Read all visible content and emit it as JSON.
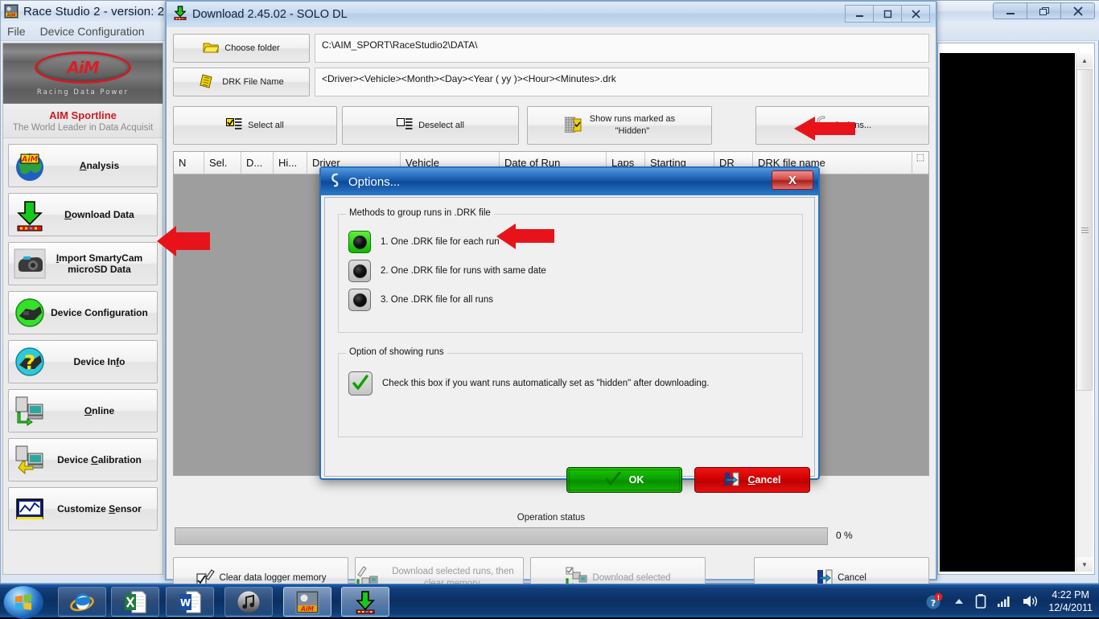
{
  "main_window": {
    "title": "Race Studio 2   - version: 2",
    "icon": "aim-app-icon",
    "menu": [
      "File",
      "Device Configuration"
    ],
    "window_buttons": [
      "minimize",
      "restore",
      "close"
    ],
    "brand": {
      "logo_text": "AiM",
      "tagline": "Racing Data Power",
      "line1": "AIM Sportline",
      "line2": "The World Leader in Data Acquisit"
    },
    "sidebar_items": [
      {
        "label": "Analysis",
        "icon": "globe-aim-icon"
      },
      {
        "label": "Download Data",
        "icon": "green-down-arrow-icon"
      },
      {
        "label": "Import SmartyCam microSD Data",
        "icon": "camera-icon"
      },
      {
        "label": "Device Configuration",
        "icon": "green-device-icon"
      },
      {
        "label": "Device Info",
        "icon": "question-mark-icon"
      },
      {
        "label": "Online",
        "icon": "pc-online-icon"
      },
      {
        "label": "Device Calibration",
        "icon": "pc-calibration-icon"
      },
      {
        "label": "Customize Sensor",
        "icon": "sensor-graph-icon"
      }
    ]
  },
  "download_window": {
    "title": "Download 2.45.02 - SOLO DL",
    "icon": "download-arrow-icon",
    "window_buttons": [
      "minimize",
      "restore",
      "close"
    ],
    "choose_folder_button": "Choose folder",
    "folder_path": "C:\\AIM_SPORT\\RaceStudio2\\DATA\\",
    "drk_file_name_button": "DRK File Name",
    "drk_file_pattern": "<Driver><Vehicle><Month><Day><Year ( yy )><Hour><Minutes>.drk",
    "toolbar": {
      "select_all": "Select all",
      "deselect_all": "Deselect all",
      "show_hidden_line1": "Show runs marked as",
      "show_hidden_line2": "\"Hidden\"",
      "options": "Options..."
    },
    "table_columns": [
      "N",
      "Sel.",
      "D...",
      "Hi...",
      "Driver",
      "Vehicle",
      "Date of Run",
      "Laps",
      "Starting",
      "DR",
      "DRK file name"
    ],
    "table_rows": [],
    "operation_status_label": "Operation status",
    "progress_percent": "0 %",
    "bottom_buttons": [
      {
        "label": "Clear data logger memory",
        "icon": "clear-memory-icon",
        "disabled": false
      },
      {
        "label": "Download selected runs, then clear memory.",
        "icon": "download-clear-icon",
        "disabled": true
      },
      {
        "label": "Download selected",
        "icon": "download-selected-icon",
        "disabled": true
      },
      {
        "label": "Cancel",
        "icon": "cancel-icon",
        "disabled": false
      }
    ]
  },
  "options_dialog": {
    "title": "Options...",
    "icon": "options-icon",
    "close_label": "X",
    "group1_label": "Methods to group runs in .DRK file",
    "radio_options": [
      {
        "label": "1.  One .DRK file for each run",
        "selected": true
      },
      {
        "label": "2.  One .DRK file for runs with same date",
        "selected": false
      },
      {
        "label": "3.  One .DRK file for all runs",
        "selected": false
      }
    ],
    "group2_label": "Option of showing runs",
    "checkbox": {
      "label": "Check this box if you want runs automatically set as \"hidden\" after downloading.",
      "checked": true
    },
    "ok_label": "OK",
    "cancel_label": "Cancel"
  },
  "annotations": [
    {
      "name": "arrow-to-download-data",
      "color": "#e8131a"
    },
    {
      "name": "arrow-to-options-button",
      "color": "#e8131a"
    },
    {
      "name": "arrow-to-first-radio",
      "color": "#e8131a"
    }
  ],
  "taskbar": {
    "start_label": "Start",
    "items": [
      {
        "name": "internet-explorer",
        "active": false
      },
      {
        "name": "excel",
        "active": false
      },
      {
        "name": "word",
        "active": false
      },
      {
        "name": "itunes",
        "active": false
      },
      {
        "name": "race-studio-2",
        "active": true
      },
      {
        "name": "download-app",
        "active": true
      }
    ],
    "tray": [
      "action-center-alert-icon",
      "show-hidden-icons-icon",
      "battery-icon",
      "network-icon",
      "volume-icon"
    ],
    "time": "4:22 PM",
    "date": "12/4/2011"
  },
  "colors": {
    "accent_blue": "#1e62b4",
    "alert_red": "#e8131a",
    "ok_green": "#0aa300",
    "cancel_red": "#d00000",
    "brand_red": "#cf1b24"
  }
}
